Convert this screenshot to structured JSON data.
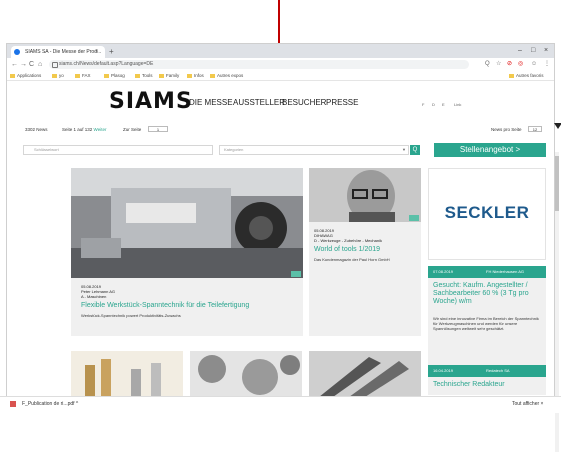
{
  "browser": {
    "tab_title": "SIAMS SA - Die Messe der Prod...",
    "tab_close": "×",
    "new_tab": "+",
    "window_controls": [
      "–",
      "□",
      "×"
    ],
    "nav": [
      "←",
      "→",
      "C",
      "⌂"
    ],
    "url": "siams.ch/News/default.asp?Language=DE",
    "extensions": [
      "Q",
      "☆",
      "⊘",
      "◎",
      "☺",
      "⋮"
    ],
    "bookmarks": [
      "Applications",
      "yo",
      "FAX",
      "Plasog",
      "Tools",
      "Family",
      "Infos",
      "Autres expos"
    ],
    "bookmarks_right": "Autres favoris"
  },
  "site": {
    "logo": "SIAMS",
    "nav": [
      "DIE MESSE",
      "AUSSTELLER",
      "BESUCHER",
      "PRESSE"
    ],
    "lang": [
      "F",
      "D",
      "E",
      "Link"
    ],
    "toolbar": {
      "count": "3302 News",
      "page_info": "Seite 1 auf 132",
      "next": "Weiter",
      "goto_label": "Zur Seite",
      "goto_value": "1",
      "per_page_label": "News pro Seite",
      "per_page_value": "12"
    },
    "search_placeholder": "Schlüsselwort",
    "category_placeholder": "Kategorien",
    "search_btn": "Q",
    "stellen_btn": "Stellenangebot >"
  },
  "cards": {
    "main": {
      "date": "05.08.2019",
      "company": "Peter Lehmann AG",
      "category": "A - Maschinen",
      "title": "Flexible Werkstück-Spanntechnik für die Teilefertigung",
      "teaser": "Werkstück-Spanntechnik powert Produktivitäts-Zuwachs"
    },
    "mid": {
      "date": "05.08.2019",
      "company": "DIHAWAG",
      "category": "D - Werkzeuge - Zubehöre - Mechanik",
      "title": "World of tools 1/2019",
      "teaser": "Das Kundenmagazin der Paul Horn GmbH"
    },
    "ad": {
      "brand": "SECKLER"
    },
    "job1": {
      "date": "07.08.2019",
      "company": "FH Niederhausen AG",
      "title": "Gesucht: Kaufm. Angestellter / Sachbearbeiter 60 % (3 Tg pro Woche) w/m",
      "teaser": "Wir sind eine innovative Firma im Bereich der Spanntechnik für Werkzeugmaschinen und werden für unsere Spannlösungen weltweit sehr geschätzt."
    },
    "job2": {
      "date": "16.04.2019",
      "company": "Redatech SA",
      "title": "Technischer Redakteur"
    }
  },
  "download": {
    "file": "F_Publication de ri...pdf",
    "caret": "^",
    "right": "Tout afficher",
    "close": "×"
  },
  "colors": {
    "accent": "#2aa58e",
    "arrow": "#c00000"
  }
}
